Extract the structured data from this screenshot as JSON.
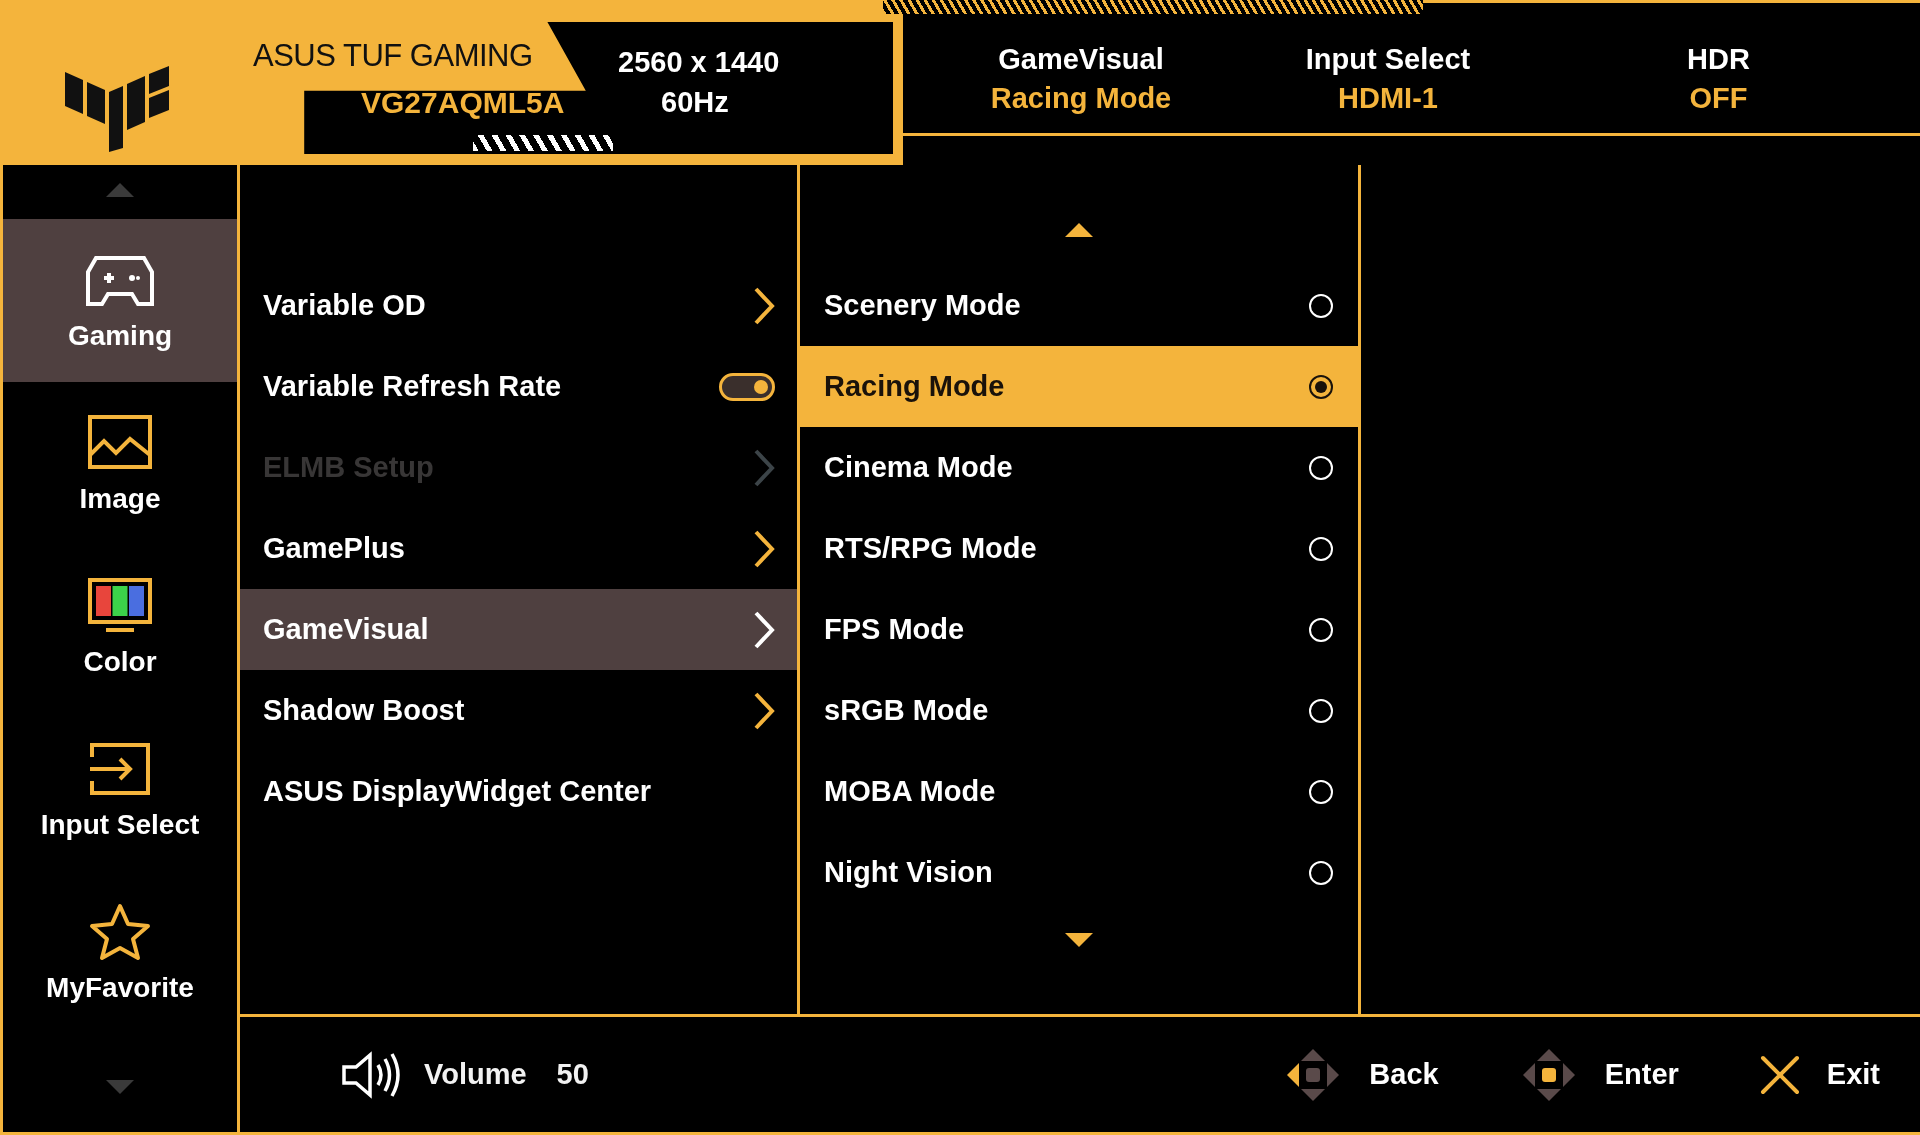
{
  "header": {
    "brand": "ASUS TUF GAMING",
    "model": "VG27AQML5A",
    "resolution": "2560 x 1440",
    "refresh_rate": "60Hz",
    "status": [
      {
        "label": "GameVisual",
        "value": "Racing Mode"
      },
      {
        "label": "Input Select",
        "value": "HDMI-1"
      },
      {
        "label": "HDR",
        "value": "OFF"
      }
    ]
  },
  "sidebar": {
    "items": [
      {
        "label": "Gaming",
        "kind": "gaming",
        "selected": true
      },
      {
        "label": "Image",
        "kind": "image",
        "selected": false
      },
      {
        "label": "Color",
        "kind": "color",
        "selected": false
      },
      {
        "label": "Input Select",
        "kind": "input",
        "selected": false
      },
      {
        "label": "MyFavorite",
        "kind": "favorite",
        "selected": false
      }
    ]
  },
  "menu": {
    "items": [
      {
        "label": "Variable OD",
        "kind": "submenu",
        "selected": false,
        "disabled": false
      },
      {
        "label": "Variable Refresh Rate",
        "kind": "toggle",
        "on": true,
        "selected": false,
        "disabled": false
      },
      {
        "label": "ELMB Setup",
        "kind": "submenu",
        "selected": false,
        "disabled": true
      },
      {
        "label": "GamePlus",
        "kind": "submenu",
        "selected": false,
        "disabled": false
      },
      {
        "label": "GameVisual",
        "kind": "submenu",
        "selected": true,
        "disabled": false
      },
      {
        "label": "Shadow Boost",
        "kind": "submenu",
        "selected": false,
        "disabled": false
      },
      {
        "label": "ASUS DisplayWidget Center",
        "kind": "action",
        "selected": false,
        "disabled": false
      }
    ]
  },
  "options": {
    "items": [
      {
        "label": "Scenery Mode",
        "selected": false
      },
      {
        "label": "Racing Mode",
        "selected": true
      },
      {
        "label": "Cinema Mode",
        "selected": false
      },
      {
        "label": "RTS/RPG Mode",
        "selected": false
      },
      {
        "label": "FPS Mode",
        "selected": false
      },
      {
        "label": "sRGB Mode",
        "selected": false
      },
      {
        "label": "MOBA Mode",
        "selected": false
      },
      {
        "label": "Night Vision",
        "selected": false
      }
    ]
  },
  "footer": {
    "volume": {
      "label": "Volume",
      "value": "50"
    },
    "hints": [
      {
        "label": "Back",
        "kind": "back"
      },
      {
        "label": "Enter",
        "kind": "enter"
      },
      {
        "label": "Exit",
        "kind": "exit"
      }
    ]
  }
}
